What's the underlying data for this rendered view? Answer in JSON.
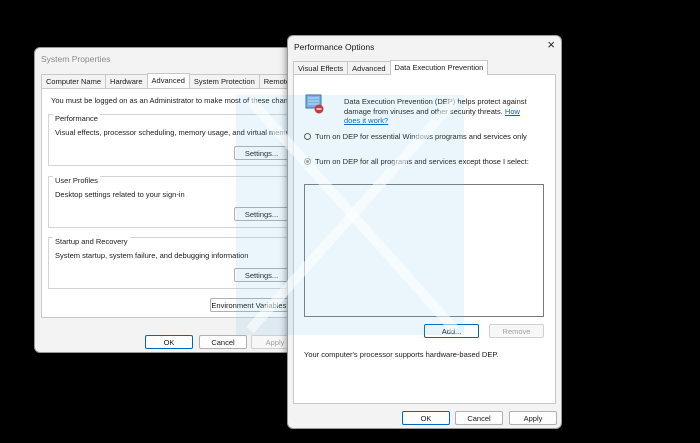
{
  "system_properties": {
    "title": "System Properties",
    "tabs": [
      "Computer Name",
      "Hardware",
      "Advanced",
      "System Protection",
      "Remote"
    ],
    "active_tab": "Advanced",
    "admin_note": "You must be logged on as an Administrator to make most of these changes.",
    "performance": {
      "title": "Performance",
      "desc": "Visual effects, processor scheduling, memory usage, and virtual memory",
      "button": "Settings..."
    },
    "user_profiles": {
      "title": "User Profiles",
      "desc": "Desktop settings related to your sign-in",
      "button": "Settings..."
    },
    "startup_recovery": {
      "title": "Startup and Recovery",
      "desc": "System startup, system failure, and debugging information",
      "button": "Settings..."
    },
    "env_button": "Environment Variables...",
    "ok": "OK",
    "cancel": "Cancel",
    "apply": "Apply"
  },
  "performance_options": {
    "title": "Performance Options",
    "close_glyph": "×",
    "tabs": [
      "Visual Effects",
      "Advanced",
      "Data Execution Prevention"
    ],
    "active_tab": "Data Execution Prevention",
    "dep_desc_line1": "Data Execution Prevention (DEP) helps protect against",
    "dep_desc_line2": "damage from viruses and other security threats.",
    "dep_link_part1": "How",
    "dep_link_part2": "does it work?",
    "radio_essential": "Turn on DEP for essential Windows programs and services only",
    "radio_all": "Turn on DEP for all programs and services except those I select:",
    "selected_radio": "all",
    "add_button": "Add...",
    "remove_button": "Remove",
    "support_note": "Your computer's processor supports hardware-based DEP.",
    "ok": "OK",
    "cancel": "Cancel",
    "apply": "Apply"
  },
  "icons": {
    "dep": "shield-cpu-icon",
    "close": "close-icon"
  },
  "colors": {
    "accent": "#0067c0",
    "watermark": "#5ab4e6"
  }
}
